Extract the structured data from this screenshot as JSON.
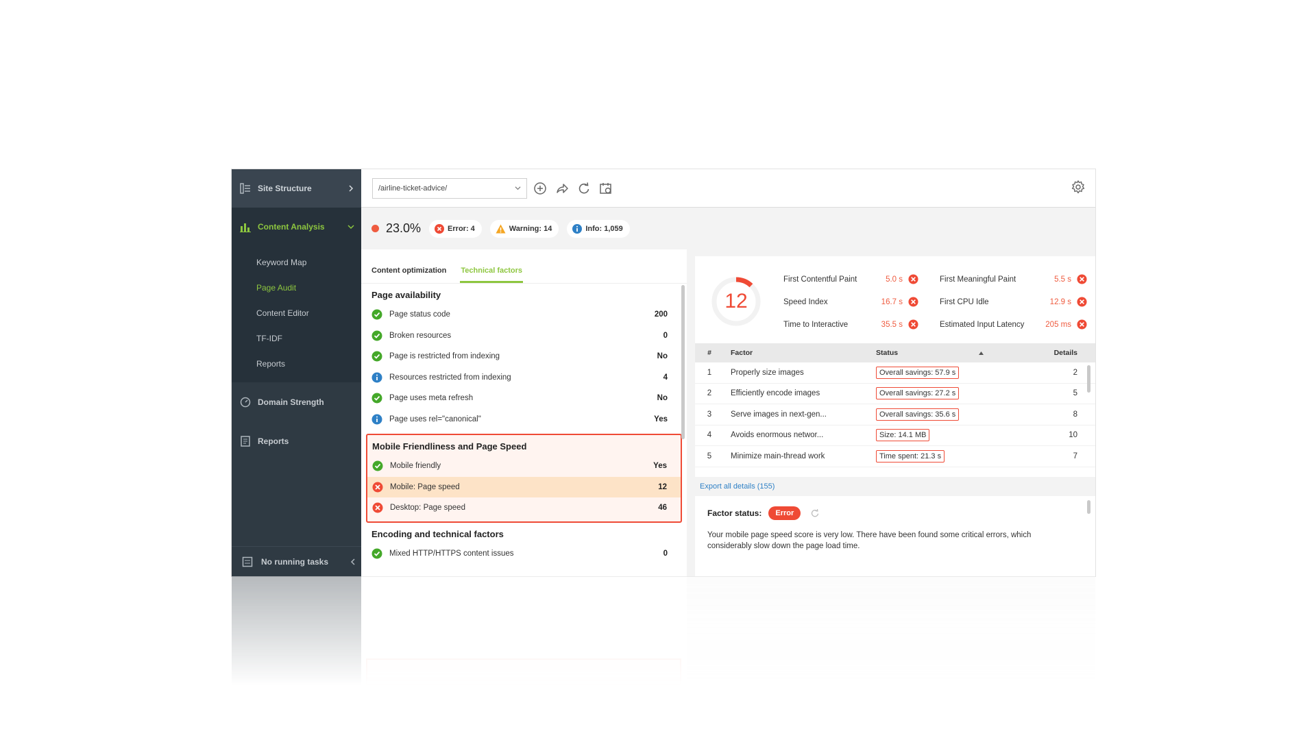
{
  "sidebar": {
    "site_structure": "Site Structure",
    "content_analysis": "Content Analysis",
    "sub_items": [
      {
        "label": "Keyword Map"
      },
      {
        "label": "Page Audit"
      },
      {
        "label": "Content Editor"
      },
      {
        "label": "TF-IDF"
      },
      {
        "label": "Reports"
      }
    ],
    "domain_strength": "Domain Strength",
    "reports": "Reports",
    "tasks": "No running tasks"
  },
  "toolbar": {
    "url": "/airline-ticket-advice/"
  },
  "status": {
    "score": "23.0%",
    "error": "Error: 4",
    "warning": "Warning: 14",
    "info": "Info: 1,059"
  },
  "tabs": {
    "content": "Content optimization",
    "technical": "Technical factors"
  },
  "groups": {
    "availability": {
      "title": "Page availability",
      "rows": [
        {
          "name": "Page status code",
          "value": "200"
        },
        {
          "name": "Broken resources",
          "value": "0"
        },
        {
          "name": "Page is restricted from indexing",
          "value": "No"
        },
        {
          "name": "Resources restricted from indexing",
          "value": "4"
        },
        {
          "name": "Page uses meta refresh",
          "value": "No"
        },
        {
          "name": "Page uses rel=\"canonical\"",
          "value": "Yes"
        }
      ]
    },
    "mobile": {
      "title": "Mobile Friendliness and Page Speed",
      "rows": [
        {
          "name": "Mobile friendly",
          "value": "Yes"
        },
        {
          "name": "Mobile: Page speed",
          "value": "12"
        },
        {
          "name": "Desktop: Page speed",
          "value": "46"
        }
      ]
    },
    "encoding": {
      "title": "Encoding and technical factors",
      "rows": [
        {
          "name": "Mixed HTTP/HTTPS content issues",
          "value": "0"
        }
      ]
    }
  },
  "metrics": {
    "score": "12",
    "score_fraction": 0.12,
    "items": [
      {
        "label": "First Contentful Paint",
        "value": "5.0 s"
      },
      {
        "label": "Speed Index",
        "value": "16.7 s"
      },
      {
        "label": "Time to Interactive",
        "value": "35.5 s"
      },
      {
        "label": "First Meaningful Paint",
        "value": "5.5 s"
      },
      {
        "label": "First CPU Idle",
        "value": "12.9 s"
      },
      {
        "label": "Estimated Input Latency",
        "value": "205 ms"
      }
    ]
  },
  "table": {
    "headers": {
      "num": "#",
      "factor": "Factor",
      "status": "Status",
      "details": "Details"
    },
    "rows": [
      {
        "num": "1",
        "factor": "Properly size images",
        "status": "Overall savings: 57.9 s",
        "details": "2"
      },
      {
        "num": "2",
        "factor": "Efficiently encode images",
        "status": "Overall savings: 27.2 s",
        "details": "5"
      },
      {
        "num": "3",
        "factor": "Serve images in next-gen...",
        "status": "Overall savings: 35.6 s",
        "details": "8"
      },
      {
        "num": "4",
        "factor": "Avoids enormous networ...",
        "status": "Size: 14.1 MB",
        "details": "10"
      },
      {
        "num": "5",
        "factor": "Minimize main-thread work",
        "status": "Time spent: 21.3 s",
        "details": "7"
      }
    ],
    "export": "Export all details (155)"
  },
  "detail": {
    "label": "Factor status:",
    "badge": "Error",
    "text": "Your mobile page speed score is very low. There have been found some critical errors, which considerably slow down the page load time."
  },
  "colors": {
    "accent": "#8dc63f",
    "error": "#ef4a35",
    "warning": "#f5a623",
    "info": "#2e80c6",
    "sidebar": "#2f3a43"
  }
}
